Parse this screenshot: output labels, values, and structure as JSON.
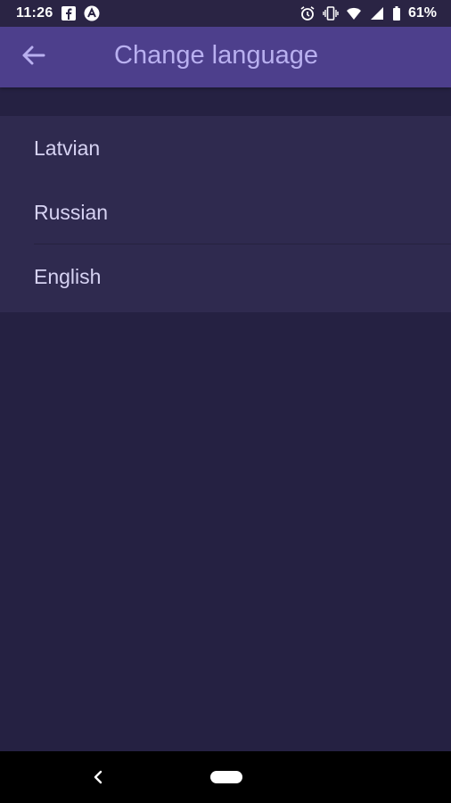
{
  "status_bar": {
    "time": "11:26",
    "battery_percent": "61%",
    "icons": [
      "facebook-icon",
      "app-notification-icon",
      "alarm-icon",
      "vibrate-icon",
      "wifi-icon",
      "signal-icon",
      "battery-icon"
    ]
  },
  "app_bar": {
    "title": "Change language",
    "back_icon": "arrow-left-icon"
  },
  "languages": [
    {
      "label": "Latvian"
    },
    {
      "label": "Russian"
    },
    {
      "label": "English"
    }
  ],
  "colors": {
    "background": "#252142",
    "app_bar": "#4d3f8c",
    "list_background": "#2f2a4f",
    "title_text": "#b9b0f0",
    "item_text": "#d6d2f2"
  }
}
